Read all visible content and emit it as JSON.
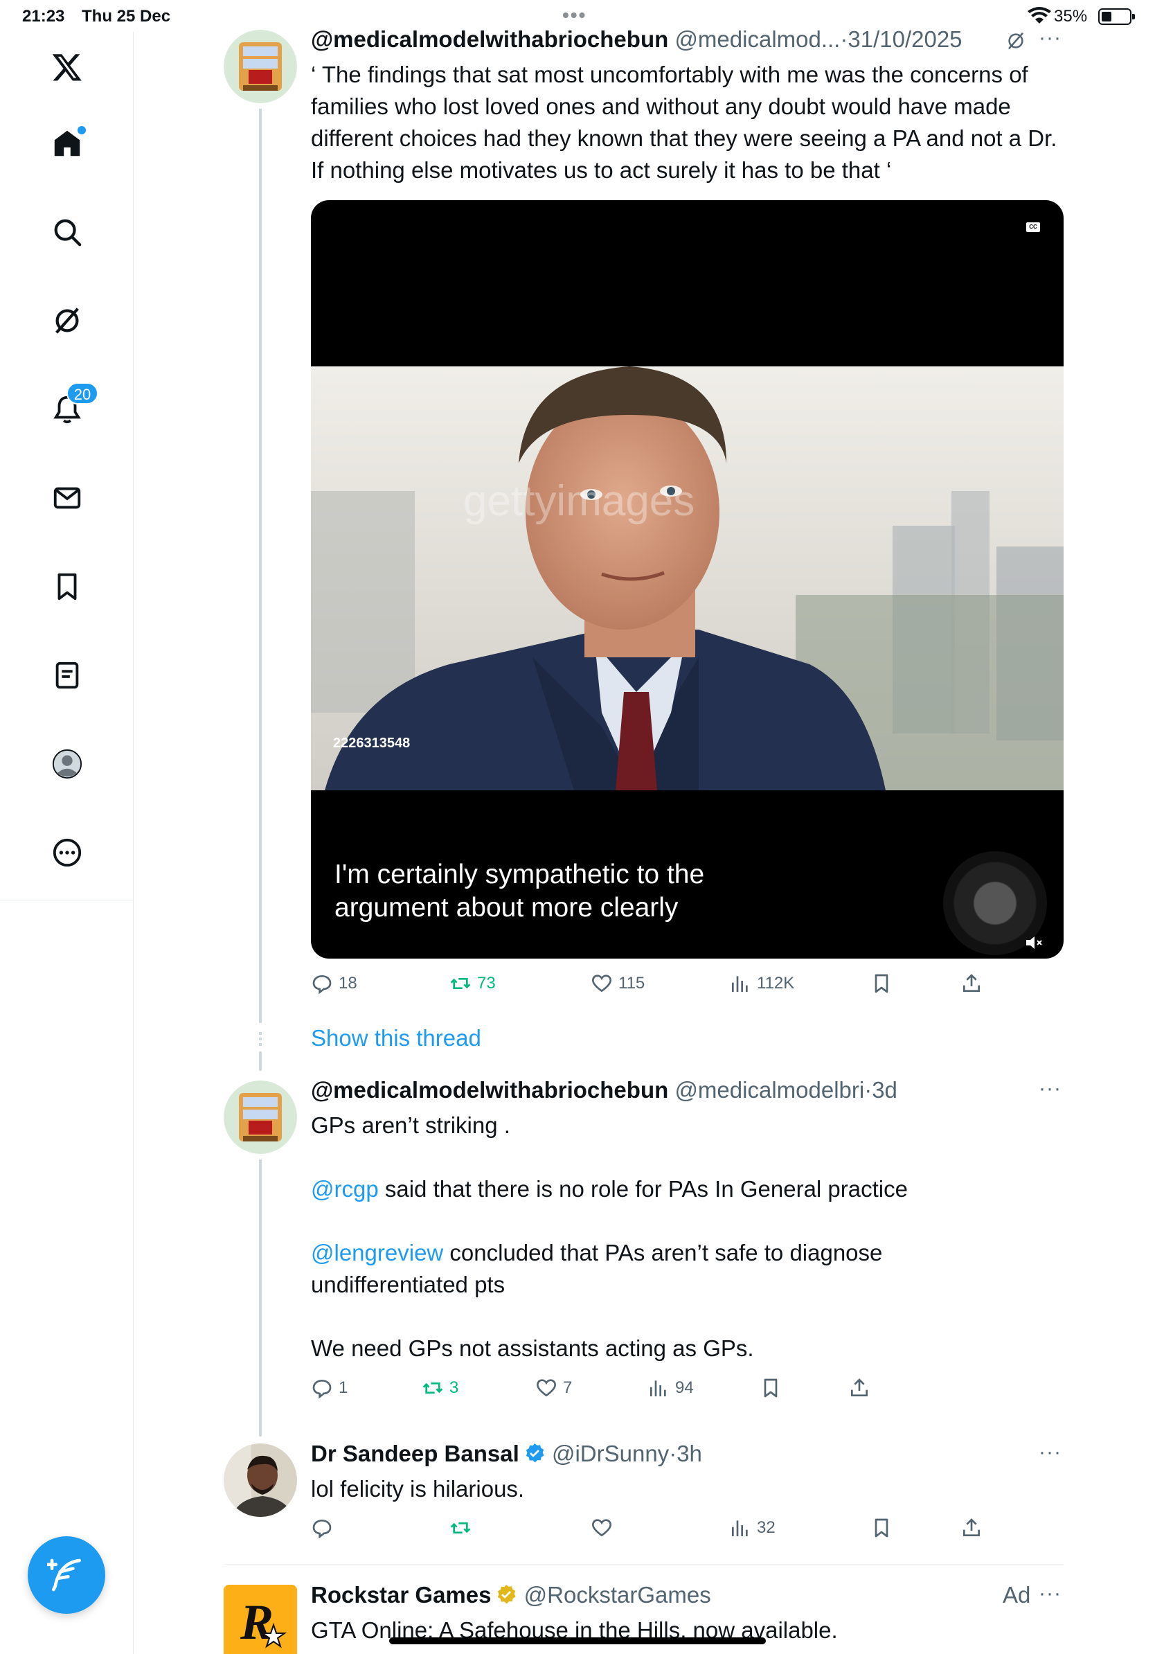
{
  "status_bar": {
    "time": "21:23",
    "date": "Thu 25 Dec",
    "battery_pct": "35%"
  },
  "sidebar": {
    "items": [
      {
        "name": "x-logo"
      },
      {
        "name": "home"
      },
      {
        "name": "search"
      },
      {
        "name": "grok"
      },
      {
        "name": "notifications",
        "badge": "20"
      },
      {
        "name": "messages"
      },
      {
        "name": "bookmarks"
      },
      {
        "name": "lists"
      },
      {
        "name": "profile"
      },
      {
        "name": "more"
      }
    ]
  },
  "colors": {
    "accent": "#1d9bf0",
    "retweet": "#00ba7c",
    "secondary_text": "#536471"
  },
  "tweets": [
    {
      "name": "@medicalmodelwithabriochebun",
      "handle": "@medicalmod...",
      "sep": "·",
      "time": "31/10/2025",
      "text": "‘ The findings that sat most uncomfortably with me was the concerns of families who lost loved ones and without any doubt would have made different choices had they known that they were seeing a PA and not a Dr. If nothing else motivates us to act surely it has to be that ‘",
      "media": {
        "watermark": "gettyimages",
        "image_id": "2226313548",
        "caption_line1": "I'm certainly sympathetic to the",
        "caption_line2": "argument about more clearly",
        "cc": "CC"
      },
      "stats": {
        "replies": "18",
        "retweets": "73",
        "likes": "115",
        "views": "112K"
      }
    },
    {
      "name": "@medicalmodelwithabriochebun",
      "handle": "@medicalmodelbri",
      "sep": "·",
      "time": "3d",
      "line1": "GPs aren’t striking .",
      "mention1": "@rcgp",
      "line2": " said that there is no role for PAs In General practice",
      "mention2": "@lengreview",
      "line3a": " concluded that PAs aren’t safe to diagnose",
      "line3b": "undifferentiated pts",
      "line4": "We need GPs not assistants acting as GPs.",
      "stats": {
        "replies": "1",
        "retweets": "3",
        "likes": "7",
        "views": "94"
      }
    },
    {
      "name": "Dr Sandeep Bansal",
      "handle": "@iDrSunny",
      "sep": "·",
      "time": "3h",
      "text": "lol felicity is hilarious.",
      "stats": {
        "replies": "",
        "retweets": "",
        "likes": "",
        "views": "32"
      }
    },
    {
      "name": "Rockstar Games",
      "handle": "@RockstarGames",
      "ad_label": "Ad",
      "text": "GTA Online: A Safehouse in the Hills, now available.",
      "logo_text": "R"
    }
  ],
  "show_thread": "Show this thread",
  "more_dots": "···",
  "status_dots": "•••"
}
